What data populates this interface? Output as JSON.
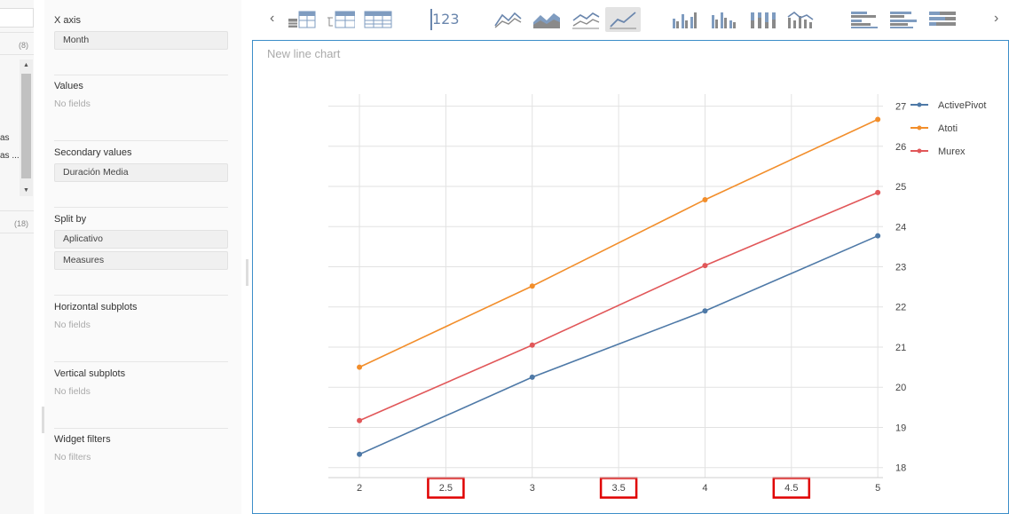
{
  "left_panel": {
    "badge_top": "(8)",
    "badge_bottom": "(18)",
    "clipped_item_1": "as",
    "clipped_item_2": "as ..."
  },
  "wizard": {
    "x_axis": {
      "title": "X axis",
      "fields": [
        "Month"
      ]
    },
    "values": {
      "title": "Values",
      "empty": "No fields"
    },
    "secondary_values": {
      "title": "Secondary values",
      "fields": [
        "Duración Media"
      ]
    },
    "split_by": {
      "title": "Split by",
      "fields": [
        "Aplicativo",
        "Measures"
      ]
    },
    "horizontal_subplots": {
      "title": "Horizontal subplots",
      "empty": "No fields"
    },
    "vertical_subplots": {
      "title": "Vertical subplots",
      "empty": "No fields"
    },
    "widget_filters": {
      "title": "Widget filters",
      "empty": "No filters"
    }
  },
  "toolbar": {
    "prev": "‹",
    "next": "›",
    "kpi_label": "123",
    "icons": [
      "table-icon",
      "tree-table-icon",
      "pivot-table-icon",
      "kpi-icon",
      "line-chart-icon",
      "area-chart-icon",
      "stacked-area-icon",
      "line-chart-selected-icon",
      "column-chart-icon",
      "clustered-column-icon",
      "stacked-column-icon",
      "combo-chart-icon",
      "bar-chart-icon",
      "clustered-bar-icon",
      "stacked-bar-icon"
    ],
    "accent": "#6a86ad"
  },
  "chart": {
    "title": "New line chart",
    "border_color": "#3c8ec9",
    "highlight_color": "#e00000",
    "highlighted_ticks": [
      "2.5",
      "3.5",
      "4.5"
    ]
  },
  "chart_data": {
    "type": "line",
    "title": "New line chart",
    "x_ticks": [
      "2",
      "2.5",
      "3",
      "3.5",
      "4",
      "4.5",
      "5"
    ],
    "y_ticks": [
      "18",
      "19",
      "20",
      "21",
      "22",
      "23",
      "24",
      "25",
      "26",
      "27"
    ],
    "y_axis_side": "right",
    "xlim": [
      1.82,
      5.03
    ],
    "ylim": [
      17.75,
      27.3
    ],
    "x": [
      2,
      3,
      4,
      5
    ],
    "legend_position": "top-right",
    "grid": true,
    "series": [
      {
        "name": "ActivePivot",
        "color": "#4e79a7",
        "values": [
          18.33,
          20.25,
          21.9,
          23.77
        ]
      },
      {
        "name": "Atoti",
        "color": "#f28e2b",
        "values": [
          20.5,
          22.52,
          24.67,
          26.67
        ]
      },
      {
        "name": "Murex",
        "color": "#e15759",
        "values": [
          19.17,
          21.05,
          23.03,
          24.85
        ]
      }
    ]
  }
}
